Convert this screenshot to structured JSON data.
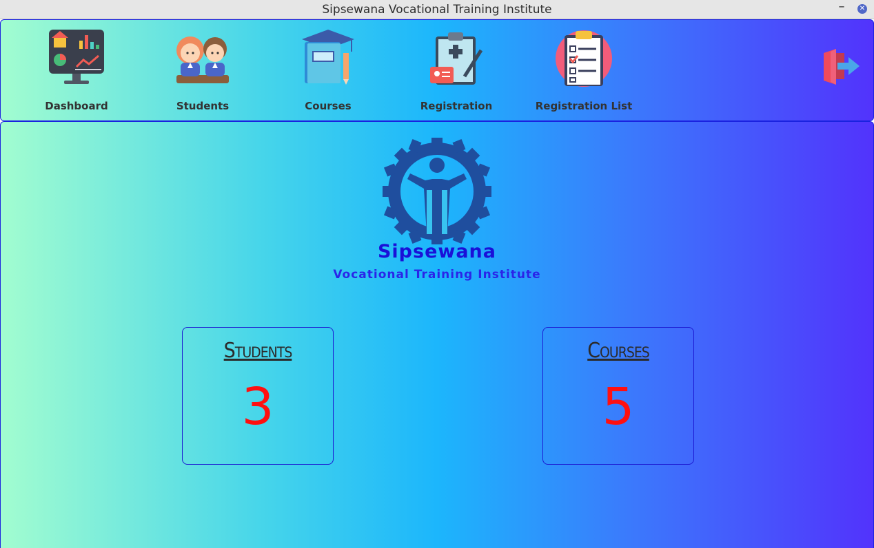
{
  "window": {
    "title": "Sipsewana Vocational Training Institute"
  },
  "nav": {
    "items": [
      {
        "label": "Dashboard",
        "icon": "dashboard-icon"
      },
      {
        "label": "Students",
        "icon": "students-icon"
      },
      {
        "label": "Courses",
        "icon": "courses-icon"
      },
      {
        "label": "Registration",
        "icon": "registration-icon"
      },
      {
        "label": "Registration List",
        "icon": "registration-list-icon"
      }
    ],
    "logout_icon": "logout-icon"
  },
  "brand": {
    "name": "Sipsewana",
    "subtitle": "Vocational Training Institute",
    "emblem_color": "#1f4e9e"
  },
  "stats": {
    "students": {
      "title": "Students",
      "value": "3"
    },
    "courses": {
      "title": "Courses",
      "value": "5"
    }
  },
  "colors": {
    "border": "#1a22e0",
    "value": "#ff1010",
    "gradient": [
      "#a2fdd0",
      "#1cb6fc",
      "#5233fc"
    ]
  }
}
